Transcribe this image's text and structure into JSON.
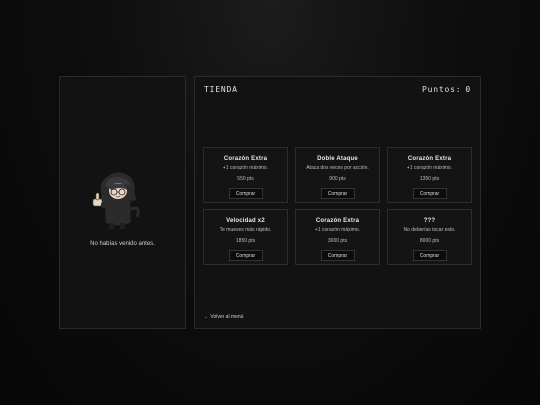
{
  "npc": {
    "message": "No habías venido antes."
  },
  "shop": {
    "title": "TIENDA",
    "points_label": "Puntos:",
    "points_value": "0",
    "buy_label": "Comprar",
    "items": [
      {
        "name": "Corazón Extra",
        "desc": "+1 corazón máximo.",
        "price": "550 pts"
      },
      {
        "name": "Doble Ataque",
        "desc": "Ataca dos veces por acción.",
        "price": "900 pts"
      },
      {
        "name": "Corazón Extra",
        "desc": "+1 corazón máximo.",
        "price": "1350 pts"
      },
      {
        "name": "Velocidad x2",
        "desc": "Te mueves más rápido.",
        "price": "1850 pts"
      },
      {
        "name": "Corazón Extra",
        "desc": "+1 corazón máximo.",
        "price": "3000 pts"
      },
      {
        "name": "???",
        "desc": "No deberías tocar esto.",
        "price": "8000 pts"
      }
    ],
    "back_label": "← Volver al menú"
  },
  "colors": {
    "background": "#0e0e0e",
    "panel": "#121212",
    "border": "#2a2a2a",
    "text": "#e0e0e0"
  }
}
